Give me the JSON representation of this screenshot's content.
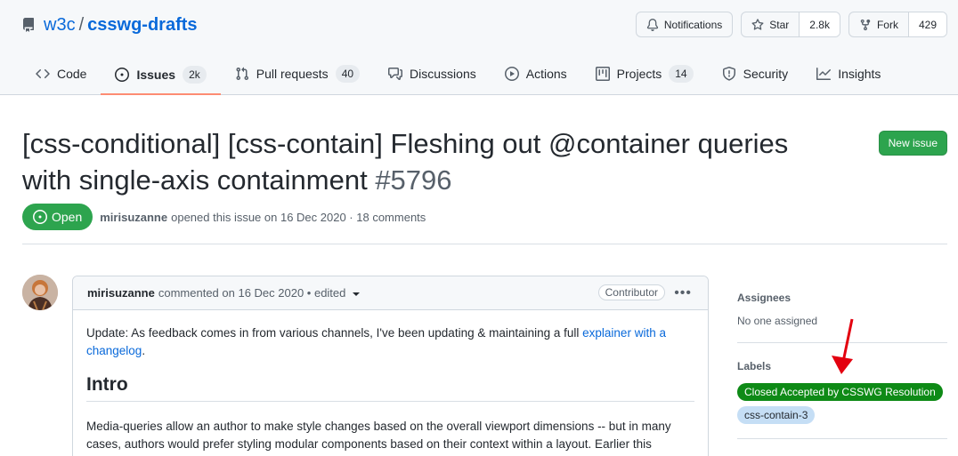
{
  "repo": {
    "owner": "w3c",
    "separator": "/",
    "name": "csswg-drafts"
  },
  "header_actions": {
    "notifications_label": "Notifications",
    "star_label": "Star",
    "star_count": "2.8k",
    "fork_label": "Fork",
    "fork_count": "429"
  },
  "nav": {
    "tabs": [
      {
        "label": "Code",
        "icon": "code-icon"
      },
      {
        "label": "Issues",
        "icon": "issue-opened-icon",
        "count": "2k",
        "selected": true
      },
      {
        "label": "Pull requests",
        "icon": "git-pull-request-icon",
        "count": "40"
      },
      {
        "label": "Discussions",
        "icon": "comment-discussion-icon"
      },
      {
        "label": "Actions",
        "icon": "play-icon"
      },
      {
        "label": "Projects",
        "icon": "table-icon",
        "count": "14"
      },
      {
        "label": "Security",
        "icon": "shield-icon"
      },
      {
        "label": "Insights",
        "icon": "graph-icon"
      }
    ]
  },
  "issue": {
    "title": "[css-conditional] [css-contain] Fleshing out @container queries with single-axis containment",
    "number": "#5796",
    "state": "Open",
    "author": "mirisuzanne",
    "meta_text": "opened this issue on 16 Dec 2020 · 18 comments",
    "new_issue_label": "New issue"
  },
  "comment": {
    "author": "mirisuzanne",
    "meta": "commented on 16 Dec 2020 • edited",
    "role": "Contributor",
    "body_text_1": "Update: As feedback comes in from various channels, I've been updating & maintaining a full ",
    "body_link": "explainer with a changelog",
    "body_text_1_end": ".",
    "heading": "Intro",
    "body_text_2": "Media-queries allow an author to make style changes based on the overall viewport dimensions -- but in many cases, authors would prefer styling modular components based on their context within a layout. Earlier this"
  },
  "sidebar": {
    "assignees_heading": "Assignees",
    "assignees_value": "No one assigned",
    "labels_heading": "Labels",
    "labels": [
      {
        "name": "Closed Accepted by CSSWG Resolution",
        "bg": "#0e8a16",
        "fg": "#ffffff"
      },
      {
        "name": "css-contain-3",
        "bg": "#c5def5",
        "fg": "#24292f"
      }
    ]
  },
  "colors": {
    "accent": "#0969da",
    "open_green": "#2da44e",
    "selected_tab_underline": "#fd8c73",
    "annotation_arrow": "#e3000f"
  }
}
